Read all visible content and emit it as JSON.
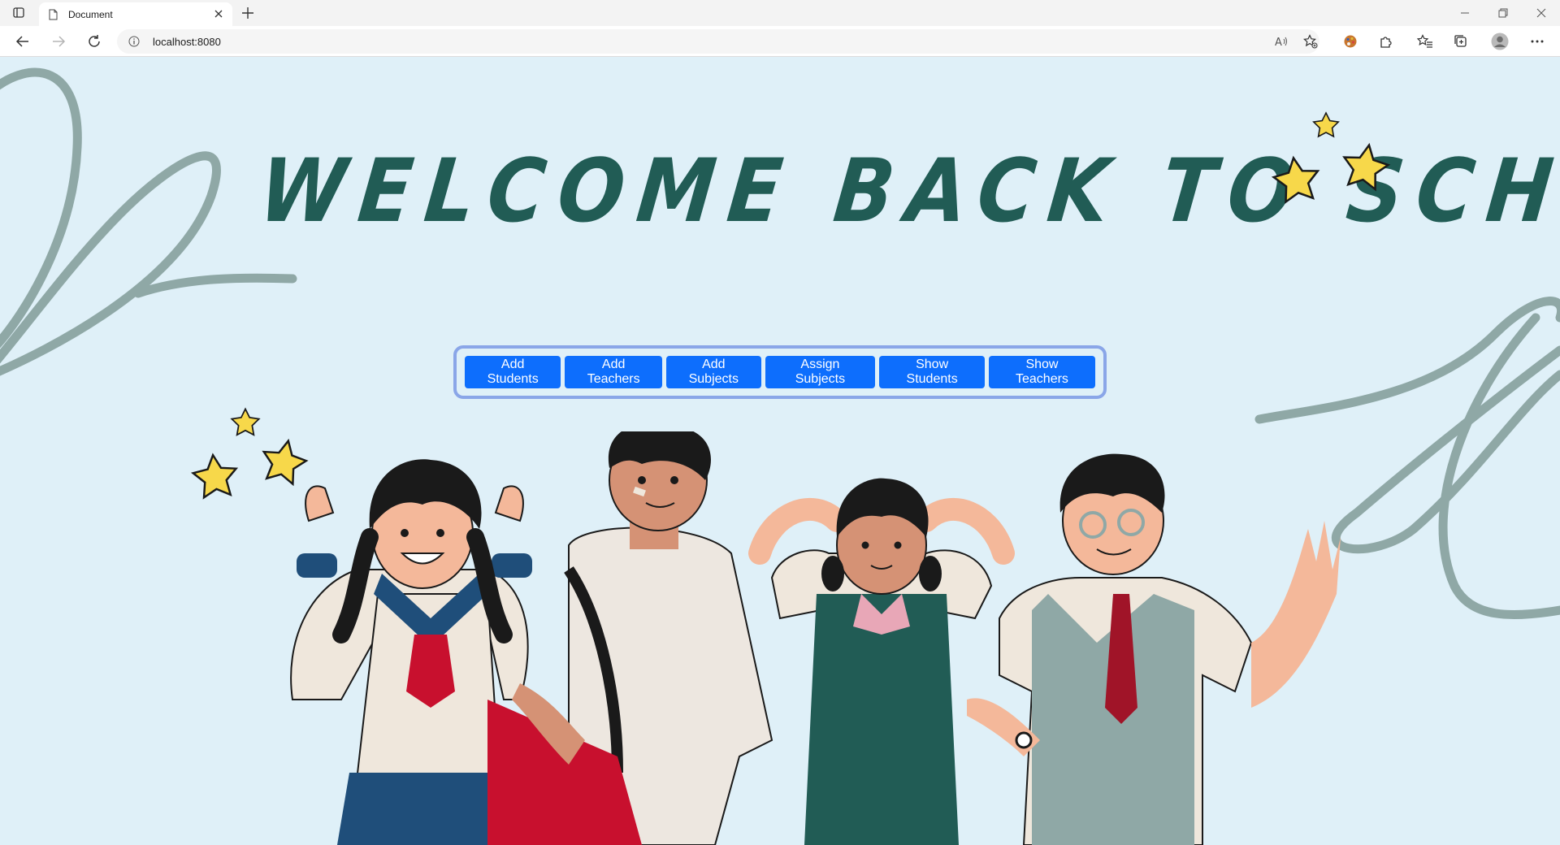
{
  "browser": {
    "tab_title": "Document",
    "url": "localhost:8080"
  },
  "page": {
    "headline": "WELCOME BACK TO SCHOOL!",
    "nav_buttons": [
      {
        "label": "Add Students"
      },
      {
        "label": "Add Teachers"
      },
      {
        "label": "Add Subjects"
      },
      {
        "label": "Assign Subjects"
      },
      {
        "label": "Show Students"
      },
      {
        "label": "Show Teachers"
      }
    ]
  },
  "colors": {
    "background": "#dff0f8",
    "headline": "#215c55",
    "button": "#0d6efd",
    "button_group_border": "#8aa6e8",
    "swirl": "#8fa8a6",
    "star": "#f7d84a"
  },
  "icons": [
    "tab-actions-icon",
    "document-icon",
    "close-icon",
    "new-tab-icon",
    "minimize-icon",
    "restore-icon",
    "window-close-icon",
    "back-icon",
    "forward-icon",
    "refresh-icon",
    "info-icon",
    "read-aloud-icon",
    "favorite-add-icon",
    "palette-extension-icon",
    "extensions-icon",
    "favorites-icon",
    "collections-icon",
    "profile-icon",
    "more-icon",
    "star-icon"
  ]
}
